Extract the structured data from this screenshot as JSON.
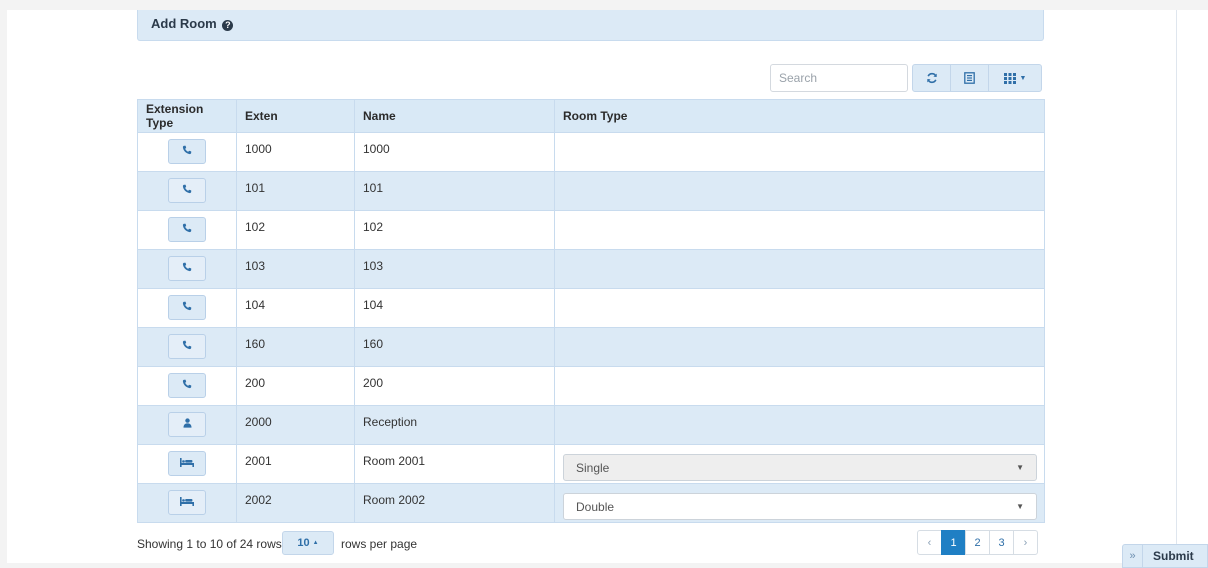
{
  "panel": {
    "title": "Add Room"
  },
  "search": {
    "placeholder": "Search"
  },
  "toolbar": {
    "refresh_icon": "refresh-icon",
    "list_icon": "list-icon",
    "columns_icon": "columns-grid-icon"
  },
  "table": {
    "headers": [
      "Extension Type",
      "Exten",
      "Name",
      "Room Type"
    ],
    "rows": [
      {
        "type_icon": "phone-icon",
        "exten": "1000",
        "name": "1000",
        "room_type": ""
      },
      {
        "type_icon": "phone-icon",
        "exten": "101",
        "name": "101",
        "room_type": ""
      },
      {
        "type_icon": "phone-icon",
        "exten": "102",
        "name": "102",
        "room_type": ""
      },
      {
        "type_icon": "phone-icon",
        "exten": "103",
        "name": "103",
        "room_type": ""
      },
      {
        "type_icon": "phone-icon",
        "exten": "104",
        "name": "104",
        "room_type": ""
      },
      {
        "type_icon": "phone-icon",
        "exten": "160",
        "name": "160",
        "room_type": ""
      },
      {
        "type_icon": "phone-icon",
        "exten": "200",
        "name": "200",
        "room_type": ""
      },
      {
        "type_icon": "user-icon",
        "exten": "2000",
        "name": "Reception",
        "room_type": ""
      },
      {
        "type_icon": "bed-icon",
        "exten": "2001",
        "name": "Room 2001",
        "room_type": "Single"
      },
      {
        "type_icon": "bed-icon",
        "exten": "2002",
        "name": "Room 2002",
        "room_type": "Double"
      }
    ]
  },
  "footer": {
    "showing": "Showing 1 to 10 of 24 rows",
    "page_size": "10",
    "rows_per_page": "rows per page"
  },
  "pagination": {
    "prev": "‹",
    "pages": [
      "1",
      "2",
      "3"
    ],
    "active": "1",
    "next": "›"
  },
  "submit": {
    "chevron": "»",
    "label": "Submit"
  },
  "colors": {
    "accent": "#1f7fc4",
    "row_alt": "#dceaf6",
    "header_bg": "#d9e9f6"
  }
}
